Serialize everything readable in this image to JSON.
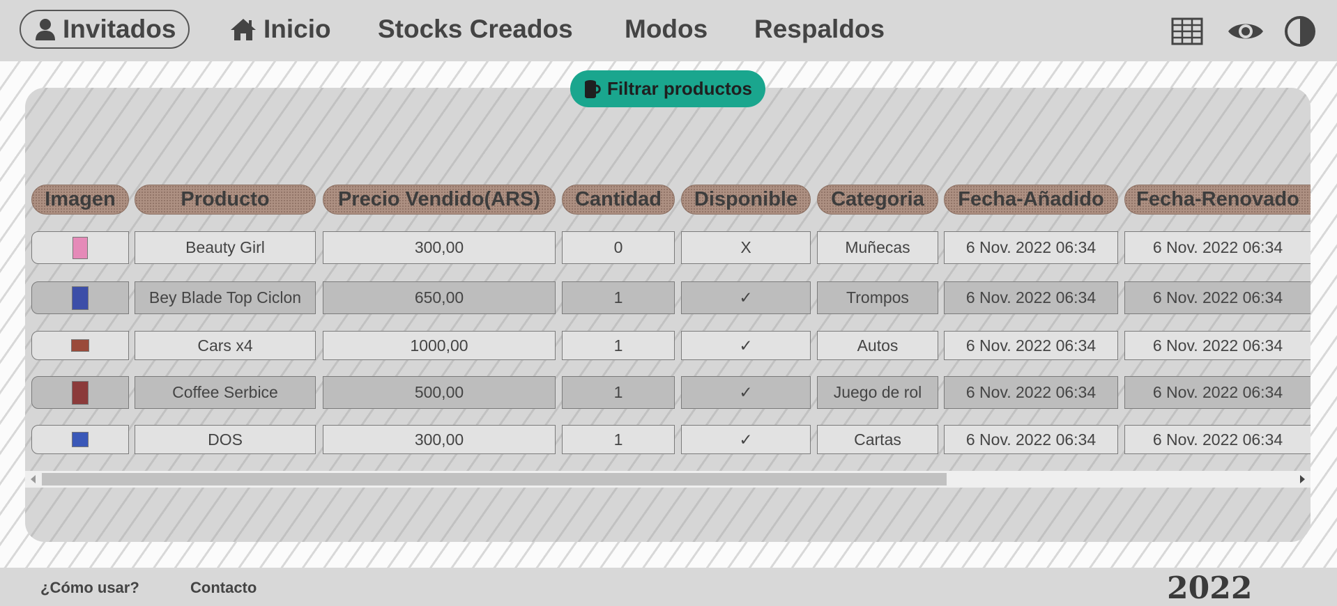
{
  "nav": {
    "guest_label": "Invitados",
    "home_label": "Inicio",
    "stocks_label": "Stocks Creados",
    "modes_label": "Modos",
    "backups_label": "Respaldos",
    "right_icons": [
      "table-grid-icon",
      "eye-icon",
      "contrast-icon"
    ]
  },
  "filter": {
    "label": "Filtrar productos",
    "icon": "mug-icon"
  },
  "table": {
    "headers": [
      "Imagen",
      "Producto",
      "Precio Vendido(ARS)",
      "Cantidad",
      "Disponible",
      "Categoria",
      "Fecha-Añadido",
      "Fecha-Renovado"
    ],
    "rows": [
      {
        "product": "Beauty Girl",
        "price": "300,00",
        "qty": "0",
        "available": "X",
        "category": "Muñecas",
        "added": "6 Nov. 2022 06:34",
        "renewed": "6 Nov. 2022 06:34",
        "thumb_color": "#e58ab8"
      },
      {
        "product": "Bey Blade Top Ciclon",
        "price": "650,00",
        "qty": "1",
        "available": "✓",
        "category": "Trompos",
        "added": "6 Nov. 2022 06:34",
        "renewed": "6 Nov. 2022 06:34",
        "thumb_color": "#3c4ea8"
      },
      {
        "product": "Cars x4",
        "price": "1000,00",
        "qty": "1",
        "available": "✓",
        "category": "Autos",
        "added": "6 Nov. 2022 06:34",
        "renewed": "6 Nov. 2022 06:34",
        "thumb_color": "#9a4a3a"
      },
      {
        "product": "Coffee Serbice",
        "price": "500,00",
        "qty": "1",
        "available": "✓",
        "category": "Juego de rol",
        "added": "6 Nov. 2022 06:34",
        "renewed": "6 Nov. 2022 06:34",
        "thumb_color": "#8b3a3a"
      },
      {
        "product": "DOS",
        "price": "300,00",
        "qty": "1",
        "available": "✓",
        "category": "Cartas",
        "added": "6 Nov. 2022 06:34",
        "renewed": "6 Nov. 2022 06:34",
        "thumb_color": "#3a58b8"
      }
    ]
  },
  "footer": {
    "how_to_label": "¿Cómo usar?",
    "contact_label": "Contacto",
    "year": "2022"
  },
  "colors": {
    "accent": "#1aa68e",
    "header_pill": "#ad9082",
    "nav_bg": "#d8d8d8",
    "panel_bg": "#d6d6d6"
  }
}
